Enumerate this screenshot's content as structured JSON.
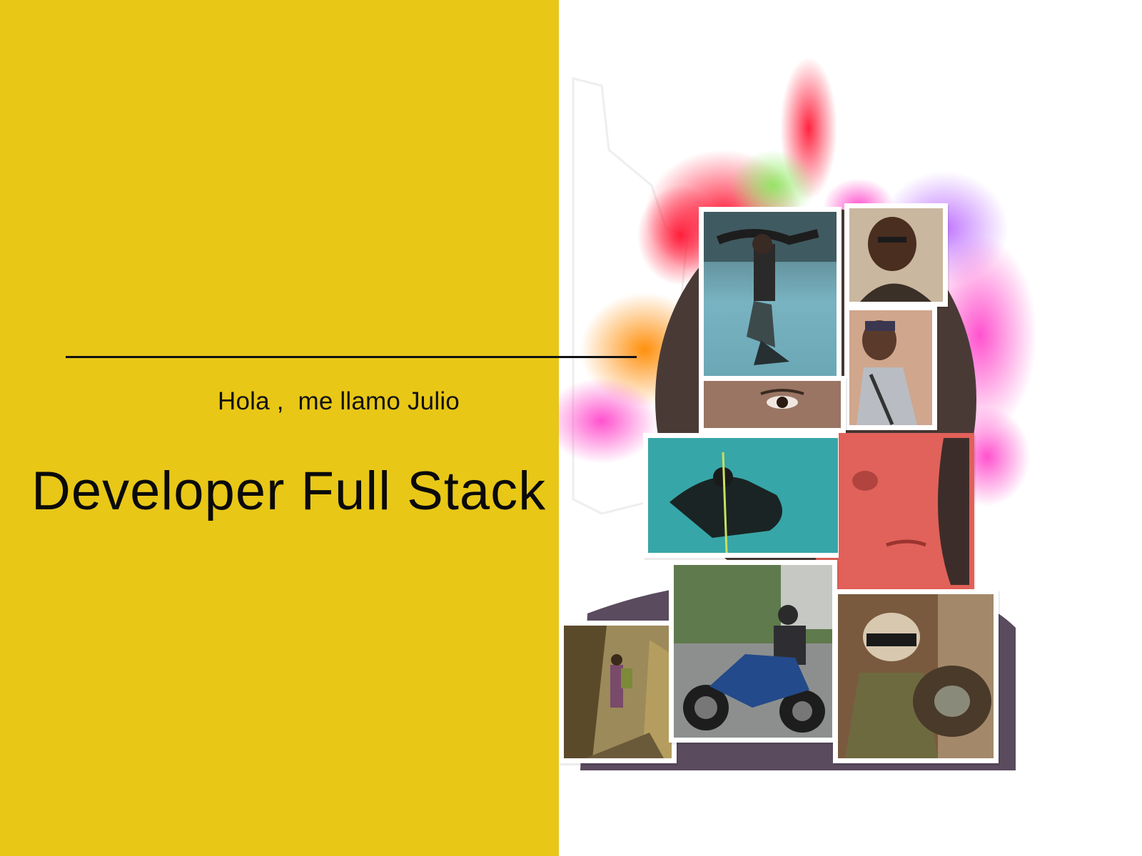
{
  "hero": {
    "greeting": "Hola ,  me llamo Julio",
    "headline": "Developer Full Stack"
  },
  "colors": {
    "accent_yellow": "#E8C717",
    "text": "#111111",
    "background": "#FFFFFF"
  },
  "collage": {
    "photos": [
      {
        "subject": "underwater-swimmer-photo"
      },
      {
        "subject": "portrait-smiling-photo"
      },
      {
        "subject": "hiker-selfie-photo"
      },
      {
        "subject": "eyes-closeup-photo"
      },
      {
        "subject": "underwater-diver-photo"
      },
      {
        "subject": "face-closeup-photo"
      },
      {
        "subject": "mountain-hiker-photo"
      },
      {
        "subject": "motorcycle-rider-photo"
      },
      {
        "subject": "motorcycle-selfie-photo"
      }
    ]
  }
}
